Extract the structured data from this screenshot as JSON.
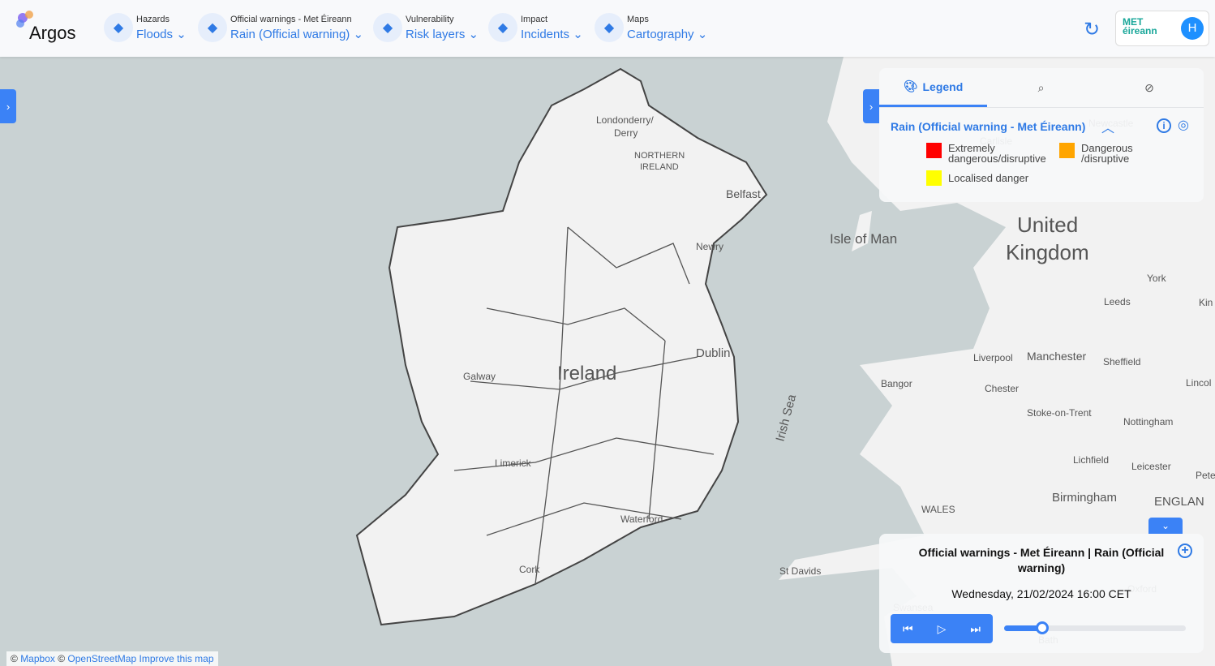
{
  "app": {
    "name": "Argos"
  },
  "nav": [
    {
      "small": "Hazards",
      "big": "Floods",
      "icon": "flood-icon"
    },
    {
      "small": "Official warnings - Met Éireann",
      "big": "Rain (Official warning)",
      "icon": "rain-warning-icon"
    },
    {
      "small": "Vulnerability",
      "big": "Risk layers",
      "icon": "life-vest-icon"
    },
    {
      "small": "Impact",
      "big": "Incidents",
      "icon": "incident-signal-icon"
    },
    {
      "small": "Maps",
      "big": "Cartography",
      "icon": "map-icon"
    }
  ],
  "header": {
    "refresh_icon": "refresh-icon",
    "partner_logo": "MET éireann",
    "avatar": "H"
  },
  "legend": {
    "tabs": [
      {
        "label": "Legend",
        "icon": "palette-icon"
      },
      {
        "label": "",
        "icon": "search-icon"
      },
      {
        "label": "",
        "icon": "compass-icon"
      }
    ],
    "layer_title": "Rain (Official warning - Met Éireann)",
    "items": [
      {
        "label_1": "Extremely",
        "label_2": "dangerous/disruptive",
        "color": "#ff0000"
      },
      {
        "label_1": "Dangerous",
        "label_2": "/disruptive",
        "color": "#ffa500"
      },
      {
        "label_1": "Localised danger",
        "label_2": "",
        "color": "#ffff00"
      }
    ]
  },
  "timeline": {
    "title": "Official warnings - Met Éireann | Rain (Official warning)",
    "datetime": "Wednesday, 21/02/2024 16:00 CET",
    "progress": 0.21
  },
  "map_labels": [
    "Londonderry/",
    "Derry",
    "NORTHERN",
    "IRELAND",
    "Belfast",
    "Newry",
    "Isle of Man",
    "United",
    "Kingdom",
    "York",
    "Leeds",
    "Liverpool",
    "Manchester",
    "Sheffield",
    "Bangor",
    "Chester",
    "Stoke-on-Trent",
    "Nottingham",
    "Lichfield",
    "Leicester",
    "Birmingham",
    "ENGLAN",
    "WALES",
    "St Davids",
    "Dublin",
    "Ireland",
    "Galway",
    "Limerick",
    "Waterford",
    "Cork",
    "Irish Sea",
    "Lincol",
    "Kin",
    "Pete",
    "Swansea",
    "Bath",
    "Oxford",
    "Carlisle",
    "Newcastle"
  ],
  "attribution": {
    "prefix": "©",
    "mapbox": "Mapbox",
    "sep": "©",
    "osm": "OpenStreetMap",
    "improve": "Improve this map"
  },
  "colors": {
    "accent": "#3b82f6",
    "sea": "#c9d2d3",
    "land": "#f2f2f2"
  }
}
